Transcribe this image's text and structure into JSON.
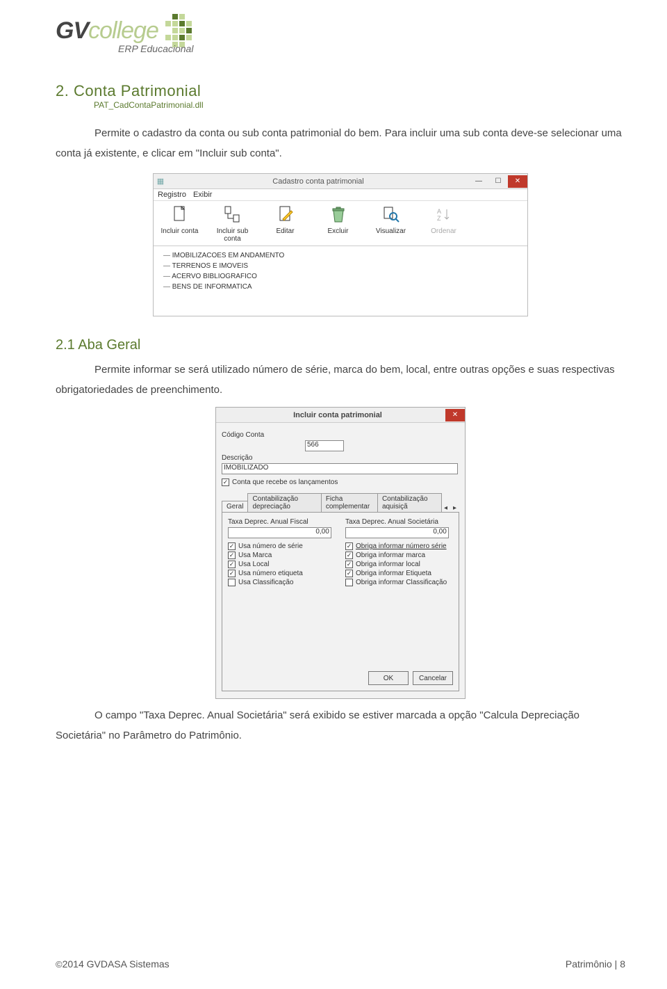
{
  "header": {
    "logo_primary": "GV",
    "logo_secondary": "college",
    "logo_sub": "ERP Educacional"
  },
  "section2": {
    "number_title": "2. Conta Patrimonial",
    "dll": "PAT_CadContaPatrimonial.dll",
    "para1": "Permite o cadastro da conta ou sub conta patrimonial do bem. Para incluir uma sub conta deve-se selecionar uma conta já existente, e clicar em \"Incluir sub conta\"."
  },
  "win1": {
    "title": "Cadastro conta patrimonial",
    "menus": [
      "Registro",
      "Exibir"
    ],
    "toolbar": [
      {
        "label": "Incluir conta",
        "disabled": false
      },
      {
        "label": "Incluir sub conta",
        "disabled": false
      },
      {
        "label": "Editar",
        "disabled": false
      },
      {
        "label": "Excluir",
        "disabled": false
      },
      {
        "label": "Visualizar",
        "disabled": false
      },
      {
        "label": "Ordenar",
        "disabled": true
      }
    ],
    "tree": [
      "IMOBILIZACOES EM ANDAMENTO",
      "TERRENOS E IMOVEIS",
      "ACERVO BIBLIOGRAFICO",
      "BENS DE INFORMATICA"
    ]
  },
  "section21": {
    "number_title": "2.1 Aba Geral",
    "para1": "Permite informar se será utilizado número de série, marca do bem, local, entre outras opções e suas respectivas obrigatoriedades de preenchimento."
  },
  "win2": {
    "title": "Incluir conta patrimonial",
    "codigo_label": "Código Conta",
    "codigo_value": "566",
    "descricao_label": "Descrição",
    "descricao_value": "IMOBILIZADO",
    "recebe_chk": {
      "checked": true,
      "label": "Conta que recebe os lançamentos"
    },
    "tabs": [
      "Geral",
      "Contabilização depreciação",
      "Ficha complementar",
      "Contabilização aquisiçã"
    ],
    "taxa_fiscal_label": "Taxa Deprec. Anual Fiscal",
    "taxa_fiscal_value": "0,00",
    "taxa_soc_label": "Taxa Deprec. Anual Societária",
    "taxa_soc_value": "0,00",
    "left_checks": [
      {
        "checked": true,
        "label": "Usa número de série"
      },
      {
        "checked": true,
        "label": "Usa Marca"
      },
      {
        "checked": true,
        "label": "Usa Local"
      },
      {
        "checked": true,
        "label": "Usa número etiqueta"
      },
      {
        "checked": false,
        "label": "Usa Classificação"
      }
    ],
    "right_checks": [
      {
        "checked": true,
        "label": "Obriga informar número série"
      },
      {
        "checked": true,
        "label": "Obriga informar marca"
      },
      {
        "checked": true,
        "label": "Obriga informar local"
      },
      {
        "checked": true,
        "label": "Obriga informar Etiqueta"
      },
      {
        "checked": false,
        "label": "Obriga informar Classificação"
      }
    ],
    "ok": "OK",
    "cancel": "Cancelar"
  },
  "trailing_para": "O campo \"Taxa Deprec. Anual Societária\" será exibido se estiver marcada a opção \"Calcula Depreciação Societária\" no Parâmetro do Patrimônio.",
  "footer": {
    "left": "2014 GVDASA Sistemas",
    "right": "Patrimônio | 8"
  }
}
